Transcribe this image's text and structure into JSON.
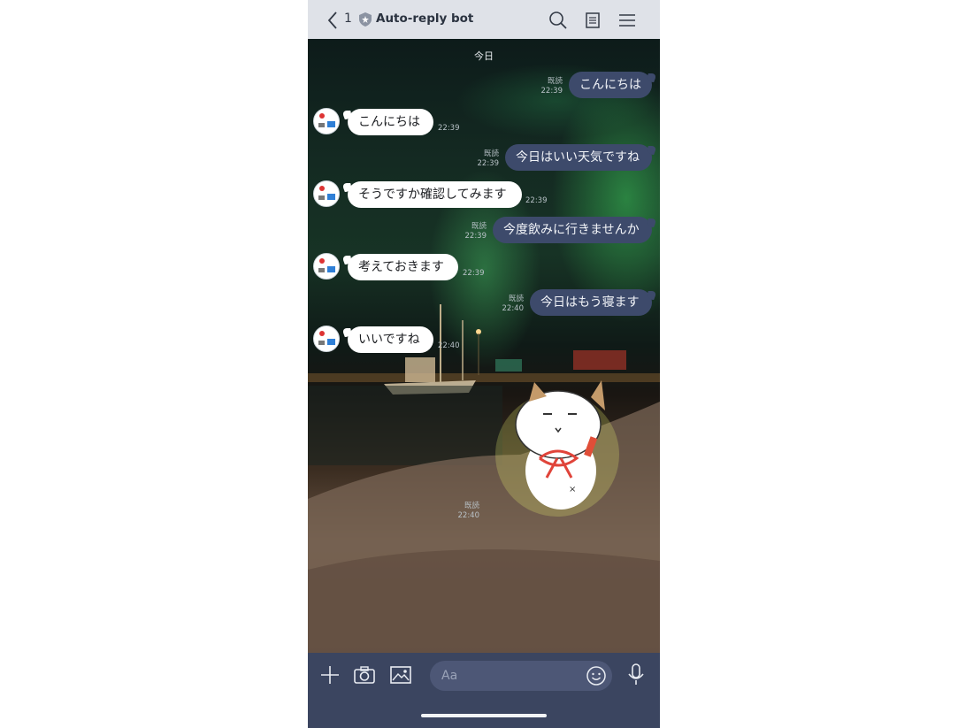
{
  "header": {
    "back_count": "1",
    "title": "Auto-reply bot",
    "icons": [
      "chevron-left-icon",
      "shield-badge-icon",
      "search-icon",
      "notes-icon",
      "menu-icon"
    ]
  },
  "chat": {
    "date_label": "今日",
    "messages": [
      {
        "side": "sent",
        "text": "こんにちは",
        "read": "既読",
        "time": "22:39"
      },
      {
        "side": "received",
        "text": "こんにちは",
        "time": "22:39"
      },
      {
        "side": "sent",
        "text": "今日はいい天気ですね",
        "read": "既読",
        "time": "22:39"
      },
      {
        "side": "received",
        "text": "そうですか確認してみます",
        "time": "22:39"
      },
      {
        "side": "sent",
        "text": "今度飲みに行きませんか",
        "read": "既読",
        "time": "22:39"
      },
      {
        "side": "received",
        "text": "考えておきます",
        "time": "22:39"
      },
      {
        "side": "sent",
        "text": "今日はもう寝ます",
        "read": "既読",
        "time": "22:40"
      },
      {
        "side": "received",
        "text": "いいですね",
        "time": "22:40"
      }
    ],
    "sticker_meta": {
      "read": "既読",
      "time": "22:40"
    }
  },
  "input_bar": {
    "placeholder": "Aa",
    "icons": [
      "plus-icon",
      "camera-icon",
      "image-icon",
      "emoji-icon",
      "microphone-icon"
    ]
  },
  "colors": {
    "header_bg": "#dfe2e8",
    "sent_bubble": "#3d4a6b",
    "received_bubble": "#ffffff",
    "bottom_bar": "#3b4560"
  }
}
